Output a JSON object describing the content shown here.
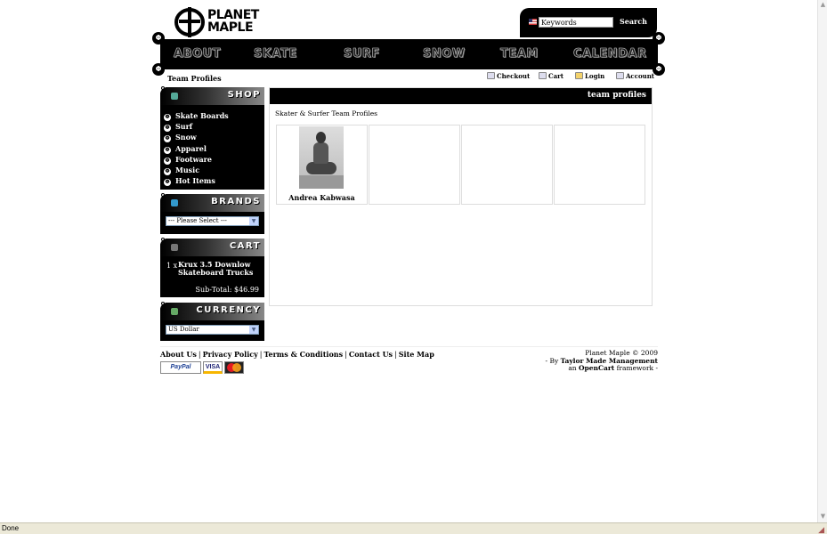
{
  "header": {
    "logo_line1": "PLANET",
    "logo_line2": "MAPLE",
    "search": {
      "placeholder": "Keywords",
      "value": "Keywords",
      "button": "Search"
    }
  },
  "nav": [
    "ABOUT",
    "SKATE",
    "SURF",
    "SNOW",
    "TEAM",
    "CALENDAR"
  ],
  "page_title": "Team Profiles",
  "toplinks": {
    "checkout": "Checkout",
    "cart": "Cart",
    "login": "Login",
    "account": "Account"
  },
  "sidebar": {
    "shop": {
      "title": "SHOP",
      "items": [
        "Skate Boards",
        "Surf",
        "Snow",
        "Apparel",
        "Footware",
        "Music",
        "Hot Items"
      ]
    },
    "brands": {
      "title": "BRANDS",
      "selected": "--- Please Select ---"
    },
    "cart": {
      "title": "CART",
      "qty": "1 x",
      "item": "Krux 3.5 Downlow Skateboard Trucks",
      "subtotal": "Sub-Total: $46.99"
    },
    "currency": {
      "title": "CURRENCY",
      "selected": "US Dollar"
    }
  },
  "main": {
    "heading": "team profiles",
    "subtitle": "Skater & Surfer Team Profiles",
    "profiles": [
      {
        "name": "Andrea Kabwasa"
      }
    ]
  },
  "footer": {
    "links": [
      "About Us",
      "Privacy Policy",
      "Terms & Conditions",
      "Contact Us",
      "Site Map"
    ],
    "payments": [
      "PayPal",
      "VISA",
      "MasterCard"
    ],
    "credit_line1": "Planet Maple © 2009",
    "credit_prefix2": "- By ",
    "credit_company": "Taylor Made Management",
    "credit_prefix3": "an ",
    "credit_framework": "OpenCart",
    "credit_suffix3": " framework -"
  },
  "statusbar": {
    "text": "Done"
  }
}
